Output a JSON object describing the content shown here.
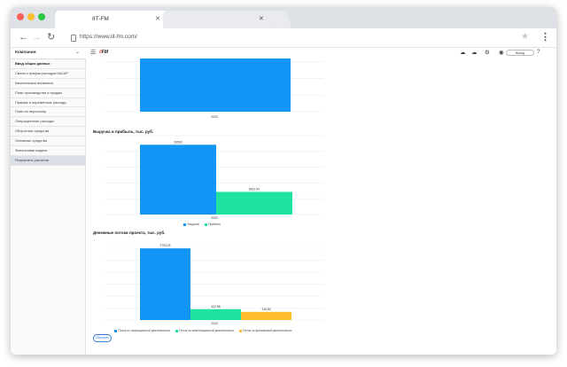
{
  "browser": {
    "tab_title": "IIT-FM",
    "close_glyph": "✕",
    "url": "https://www.iit-fm.com/",
    "icons": [
      "back-icon",
      "forward-icon",
      "reload-icon",
      "page-icon",
      "star-icon",
      "menu-icon"
    ]
  },
  "sidebar": {
    "company_label": "Компания",
    "items": [
      {
        "label": "Ввод общих данных"
      },
      {
        "label": "Смета и график расходов КиСАР"
      },
      {
        "label": "Капитальные вложения"
      },
      {
        "label": "План производства и продаж"
      },
      {
        "label": "Прямые и переменные расходы"
      },
      {
        "label": "План по персоналу"
      },
      {
        "label": "Операционные расходы"
      },
      {
        "label": "Оборотные средства"
      },
      {
        "label": "Основные средства"
      },
      {
        "label": "Финансовая модель"
      },
      {
        "label": "Результаты расчетов"
      }
    ],
    "active_item": "Результаты расчетов"
  },
  "header": {
    "logo_text": "FM",
    "logout_label": "Выход",
    "icons": [
      "cloud-download-icon",
      "cloud-upload-icon",
      "settings-icon",
      "account-icon",
      "help-icon"
    ]
  },
  "colors": {
    "blue": "#1296f5",
    "green": "#1ee3a0",
    "yellow": "#fdbd2e",
    "grid": "#ececec",
    "accent": "#2f7bd8"
  },
  "chart_data": [
    {
      "type": "bar",
      "title": "",
      "categories": [
        "2020"
      ],
      "series": [
        {
          "values": [
            26530
          ]
        }
      ],
      "ylim": [
        0,
        30000
      ],
      "grid": true,
      "partially_visible": true
    },
    {
      "type": "bar",
      "title": "Выручка и прибыль, тыс. руб.",
      "categories": [
        "2020"
      ],
      "series": [
        {
          "name": "Выручка",
          "values": [
            26530
          ],
          "label": "26530"
        },
        {
          "name": "Прибыль",
          "values": [
            8612.93
          ],
          "label": "8612.93"
        }
      ],
      "ylim": [
        0,
        30000
      ],
      "grid": true,
      "legend": "bottom"
    },
    {
      "type": "bar",
      "title": "Денежные потоки проекта, тыс. руб.",
      "categories": [
        "2020"
      ],
      "series": [
        {
          "name": "Поток по операционной деятельности",
          "values": [
            2793.25
          ],
          "label": "2793.25"
        },
        {
          "name": "Поток по инвестиционной деятельности",
          "values": [
            422.98
          ],
          "label": "422.98"
        },
        {
          "name": "Поток по финансовой деятельности",
          "values": [
            316.84
          ],
          "label": "316.84"
        }
      ],
      "ylim": [
        0,
        2800
      ],
      "grid": true,
      "legend": "bottom"
    }
  ],
  "update_button": "Обновить"
}
